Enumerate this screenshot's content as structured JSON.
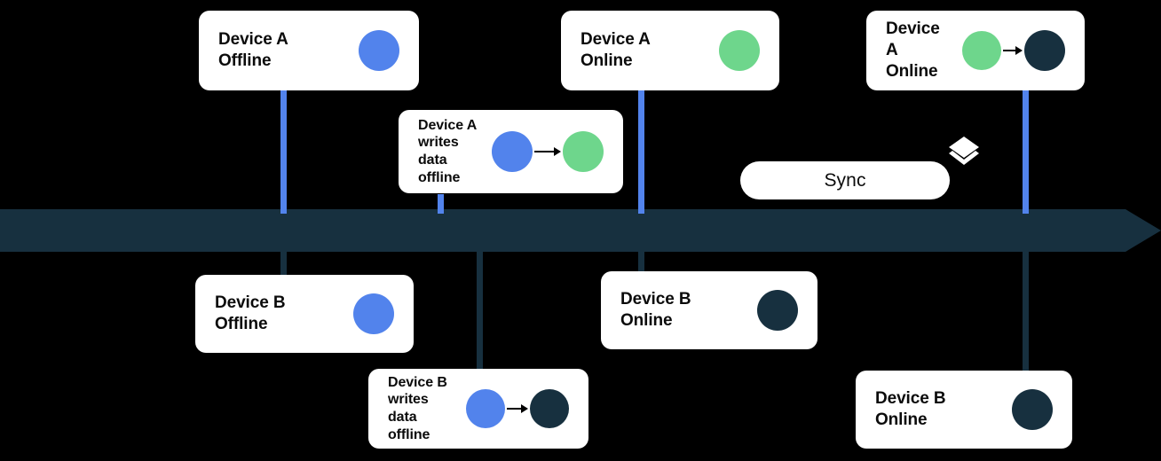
{
  "palette": {
    "background": "#000000",
    "card_bg": "#ffffff",
    "timeline": "#17303f",
    "blue": "#5283ec",
    "green": "#6ed68c",
    "navy": "#17303f",
    "text": "#0b0b0b"
  },
  "timeline": {
    "name": "timeline-axis",
    "direction": "left-to-right"
  },
  "sync": {
    "label": "Sync",
    "icon": "layers-icon"
  },
  "cards": [
    {
      "id": "device-a-offline",
      "label": "Device A\nOffline",
      "visual": [
        "blue"
      ]
    },
    {
      "id": "device-a-writes-offline",
      "label": "Device A\nwrites\ndata\noffline",
      "visual": [
        "blue",
        "arrow",
        "green"
      ]
    },
    {
      "id": "device-a-online",
      "label": "Device A\nOnline",
      "visual": [
        "green"
      ]
    },
    {
      "id": "device-a-online-sync",
      "label": "Device A\nOnline",
      "visual": [
        "green",
        "arrow",
        "navy"
      ]
    },
    {
      "id": "device-b-offline",
      "label": "Device B\nOffline",
      "visual": [
        "blue"
      ]
    },
    {
      "id": "device-b-writes-offline",
      "label": "Device B\nwrites\ndata\noffline",
      "visual": [
        "blue",
        "arrow",
        "navy"
      ]
    },
    {
      "id": "device-b-online",
      "label": "Device B\nOnline",
      "visual": [
        "navy"
      ]
    },
    {
      "id": "device-b-online-sync",
      "label": "Device B\nOnline",
      "visual": [
        "navy"
      ]
    }
  ]
}
